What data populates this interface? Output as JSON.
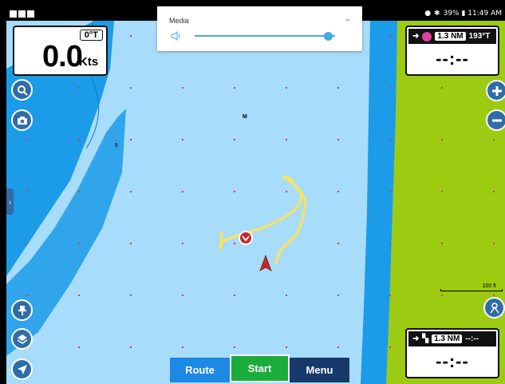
{
  "status_bar": {
    "right_text": "39% ▮ 11:49 AM"
  },
  "media": {
    "title": "Media",
    "volume_level": 0.95
  },
  "speed": {
    "heading": "0°T",
    "value": "0.0",
    "unit": "Kts"
  },
  "waypoint_top": {
    "distance": "1.3 NM",
    "bearing": "193°T",
    "time": "--:--"
  },
  "waypoint_bottom": {
    "distance": "1.3 NM",
    "bearing": "--:--",
    "time": "--:--"
  },
  "map": {
    "label_m": "M",
    "depth_label": "6",
    "scale_label": "100 ft"
  },
  "bottom_tabs": {
    "route": "Route",
    "start": "Start",
    "menu": "Menu"
  },
  "colors": {
    "water": "#a7dcfa",
    "channel": "#1b9be8",
    "land": "#9ccb12",
    "track": "#f2e36a",
    "button": "#2e6da8"
  }
}
